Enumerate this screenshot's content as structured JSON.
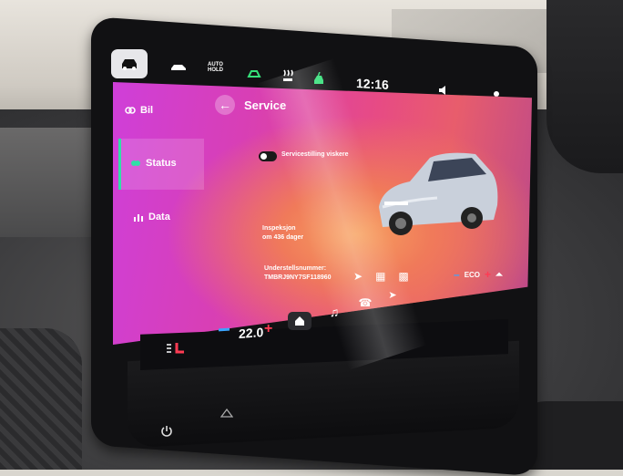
{
  "topbar": {
    "clock": "12:16",
    "auto_hold": "AUTO\nHOLD",
    "icons": [
      "car-icon",
      "car-side-icon",
      "auto-hold-badge",
      "driver-assist-icon",
      "heated-seat-icon",
      "charging-icon",
      "clock",
      "volume-icon",
      "settings-icon"
    ]
  },
  "sidebar": {
    "items": [
      {
        "label": "Bil",
        "icon": "car-icon"
      },
      {
        "label": "Status",
        "icon": "car-check-icon"
      },
      {
        "label": "Data",
        "icon": "bar-chart-icon"
      }
    ],
    "active": "Status",
    "accent_color": "#2fe0a6"
  },
  "header": {
    "title": "Service",
    "back_icon": "arrow-left-icon"
  },
  "content": {
    "toggle_label": "Servicestilling viskere",
    "inspection_title": "Inspeksjon",
    "inspection_value": "om 436 dager",
    "vin_label": "Understellsnummer:",
    "vin_value": "TMBRJ9NY7SF118960"
  },
  "dock": {
    "eco_label": "ECO",
    "icons": [
      "nav-icon",
      "phone-icon",
      "grid-icon",
      "apps-icon",
      "minus-icon",
      "plus-icon",
      "seat-icon"
    ]
  },
  "climate": {
    "temperature": "22.0",
    "icons": [
      "seat-heat-icon",
      "home-icon",
      "music-icon",
      "phone-icon",
      "navigation-icon"
    ]
  },
  "colors": {
    "screen_gradient_start": "#cf3fd9",
    "screen_gradient_end": "#e85d6c",
    "accent": "#2fe0a6",
    "minus": "#3ba5ff",
    "plus": "#ff3b53"
  }
}
